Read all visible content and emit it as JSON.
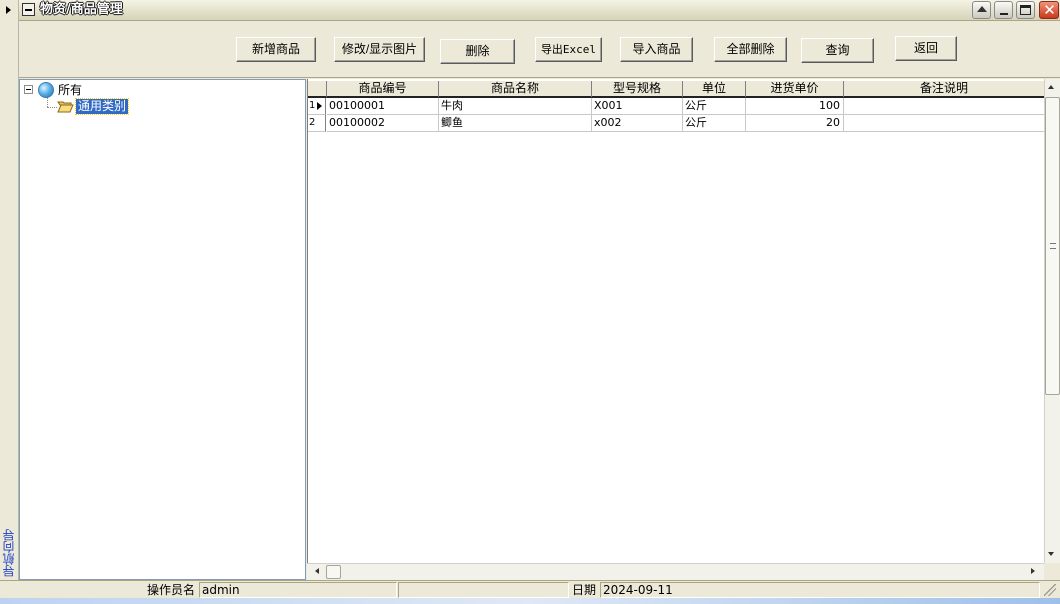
{
  "navigator": {
    "label": "导航向导",
    "arrow_icon": "expand-arrow-icon"
  },
  "window": {
    "title": "物资/商品管理"
  },
  "toolbar": {
    "new_label": "新增商品",
    "edit_label": "修改/显示图片",
    "delete_label": "删除",
    "export_label": "导出Excel",
    "import_label": "导入商品",
    "delete_all_label": "全部删除",
    "query_label": "查询",
    "back_label": "返回"
  },
  "tree": {
    "root": {
      "label": "所有",
      "icon": "globe-icon"
    },
    "children": [
      {
        "label": "通用类别",
        "icon": "open-folder-icon",
        "selected": true
      }
    ]
  },
  "grid": {
    "columns": [
      "商品编号",
      "商品名称",
      "型号规格",
      "单位",
      "进货单价",
      "备注说明"
    ],
    "rows": [
      {
        "row_no": "1",
        "cells": [
          "00100001",
          "牛肉",
          "X001",
          "公斤",
          "100",
          ""
        ]
      },
      {
        "row_no": "2",
        "cells": [
          "00100002",
          "鲫鱼",
          "x002",
          "公斤",
          "20",
          ""
        ]
      }
    ]
  },
  "status": {
    "operator_label": "操作员名",
    "operator_value": "admin",
    "date_label": "日期",
    "date_value": "2024-09-11"
  }
}
